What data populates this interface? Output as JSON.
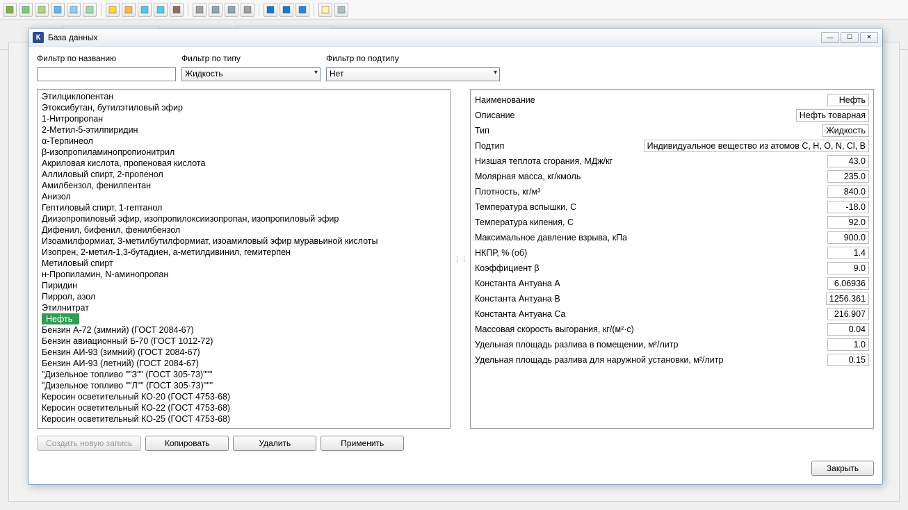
{
  "window": {
    "title": "База данных",
    "app_icon_letter": "К"
  },
  "filters": {
    "name_label": "Фильтр по названию",
    "name_value": "",
    "type_label": "Фильтр по типу",
    "type_value": "Жидкость",
    "subtype_label": "Фильтр по подтипу",
    "subtype_value": "Нет"
  },
  "list_items": [
    "Этилциклопентан",
    "Этоксибутан, бутилэтиловый эфир",
    "1-Нитропропан",
    "2-Метил-5-этилпиридин",
    "α-Терпинеол",
    "β-изопропиламинопропионитрил",
    "Акриловая кислота, пропеновая кислота",
    "Аллиловый спирт, 2-пропенол",
    "Амилбензол, фенилпентан",
    "Анизол",
    "Гептиловый спирт, 1-гептанол",
    "Диизопропиловый эфир, изопропилоксиизопропан, изопропиловый эфир",
    "Дифенил, бифенил, фенилбензол",
    "Изоамилформиат, 3-метилбутилформиат, изоамиловый эфир муравьиной кислоты",
    "Изопрен, 2-метил-1,3-бутадиен, а-метилдивинил, гемитерпен",
    "Метиловый спирт",
    "н-Пропиламин, N-аминопропан",
    "Пиридин",
    "Пиррол, азол",
    "Этилнитрат",
    "Нефть",
    "Бензин А-72 (зимний) (ГОСТ 2084-67)",
    "Бензин авиационный Б-70 (ГОСТ 1012-72)",
    "Бензин АИ-93 (зимний) (ГОСТ 2084-67)",
    "Бензин АИ-93 (летний) (ГОСТ 2084-67)",
    "\"Дизельное топливо \"\"З\"\" (ГОСТ 305-73)\"\"\"",
    "\"Дизельное топливо \"\"Л\"\" (ГОСТ 305-73)\"\"\"",
    "Керосин осветительный КО-20 (ГОСТ 4753-68)",
    "Керосин осветительный КО-22 (ГОСТ 4753-68)",
    "Керосин осветительный КО-25 (ГОСТ 4753-68)"
  ],
  "selected_index": 20,
  "details": [
    {
      "label": "Наименование",
      "value": "Нефть"
    },
    {
      "label": "Описание",
      "value": "Нефть товарная"
    },
    {
      "label": "Тип",
      "value": "Жидкость"
    },
    {
      "label": "Подтип",
      "value": "Индивидуальное вещество из атомов C, H, O, N, Cl, B"
    },
    {
      "label": "Низшая теплота сгорания, МДж/кг",
      "value": "43.0"
    },
    {
      "label": "Молярная масса, кг/кмоль",
      "value": "235.0"
    },
    {
      "label": "Плотность, кг/м³",
      "value": "840.0"
    },
    {
      "label": "Температура вспышки, С",
      "value": "-18.0"
    },
    {
      "label": "Температура кипения, С",
      "value": "92.0"
    },
    {
      "label": "Максимальное давление взрыва, кПа",
      "value": "900.0"
    },
    {
      "label": "НКПР, % (об)",
      "value": "1.4"
    },
    {
      "label": "Коэффициент β",
      "value": "9.0"
    },
    {
      "label": "Константа Антуана A",
      "value": "6.06936"
    },
    {
      "label": "Константа Антуана B",
      "value": "1256.361"
    },
    {
      "label": "Константа Антуана Ca",
      "value": "216.907"
    },
    {
      "label": "Массовая скорость выгорания, кг/(м²·с)",
      "value": "0.04"
    },
    {
      "label": "Удельная площадь разлива в помещении, м²/литр",
      "value": "1.0"
    },
    {
      "label": "Удельная площадь разлива для наружной установки, м²/литр",
      "value": "0.15"
    }
  ],
  "buttons": {
    "create": "Создать новую запись",
    "copy": "Копировать",
    "delete": "Удалить",
    "apply": "Применить",
    "close": "Закрыть"
  },
  "toolbar_icons": [
    "layer-green-icon",
    "map-icon",
    "layer-grid-icon",
    "layer-blue-icon",
    "target-icon",
    "magnify-area-icon",
    "sun-icon",
    "droplet-icon",
    "rain-icon",
    "droplets-icon",
    "stack-icon",
    "anchor-icon",
    "chart-lines-icon",
    "graph-icon",
    "wave-icon",
    "play-icon",
    "fast-forward-icon",
    "search-blue-icon",
    "doc-icon",
    "list-icon"
  ],
  "toolbar_colors": {
    "layer-green-icon": "#7cb342",
    "map-icon": "#81c784",
    "layer-grid-icon": "#aed581",
    "layer-blue-icon": "#64b5f6",
    "target-icon": "#90caf9",
    "magnify-area-icon": "#a5d6a7",
    "sun-icon": "#fdd835",
    "droplet-icon": "#ffb74d",
    "rain-icon": "#4fc3f7",
    "droplets-icon": "#4dd0e1",
    "stack-icon": "#8d6e63",
    "anchor-icon": "#9e9e9e",
    "chart-lines-icon": "#90a4ae",
    "graph-icon": "#90a4ae",
    "wave-icon": "#9e9e9e",
    "play-icon": "#1976d2",
    "fast-forward-icon": "#1976d2",
    "search-blue-icon": "#1e88e5",
    "doc-icon": "#fff3b0",
    "list-icon": "#b0bec5"
  }
}
